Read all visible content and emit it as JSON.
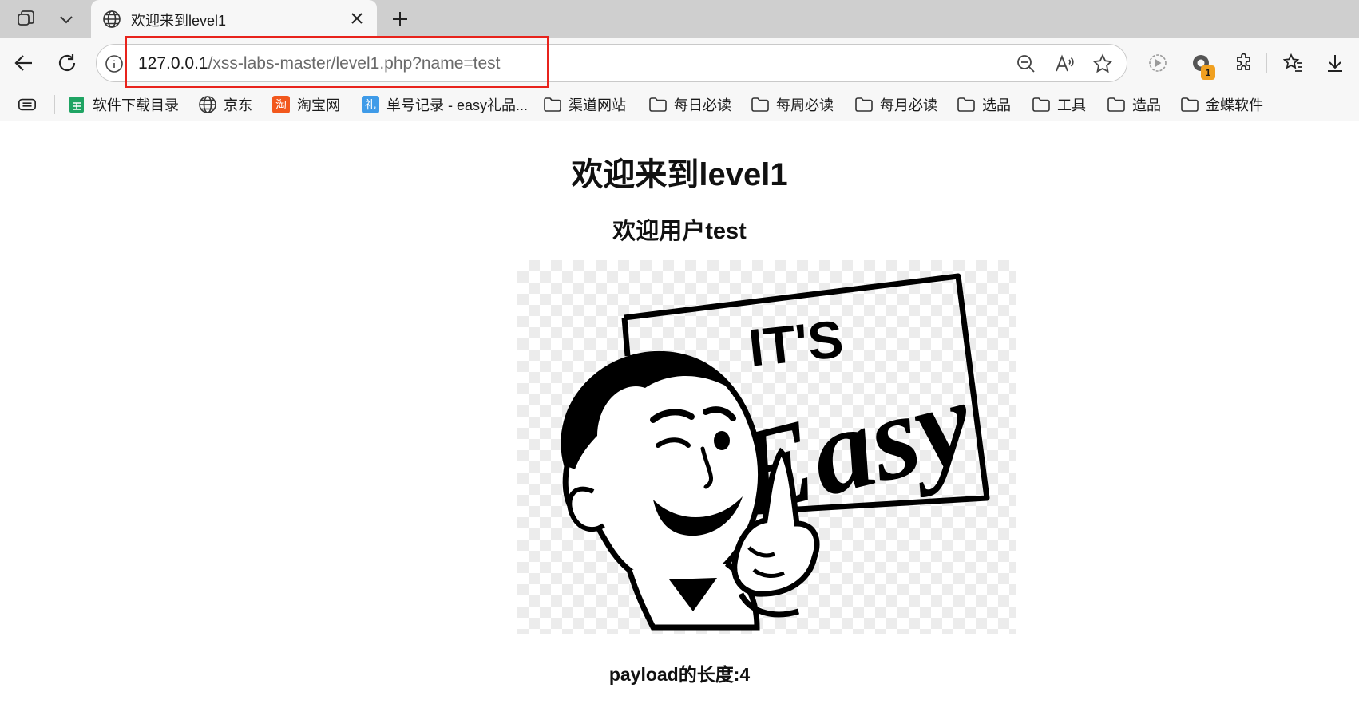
{
  "browser": {
    "tab": {
      "title": "欢迎来到level1"
    },
    "address_bar": {
      "host": "127.0.0.1",
      "path": "/xss-labs-master/level1.php?name=test"
    },
    "extension_badge": "1",
    "bookmarks": [
      {
        "label": "软件下载目录",
        "icon": "sheet-icon"
      },
      {
        "label": "京东",
        "icon": "globe-icon"
      },
      {
        "label": "淘宝网",
        "icon": "taobao-icon"
      },
      {
        "label": "单号记录 - easy礼品...",
        "icon": "gift-icon"
      },
      {
        "label": "渠道网站",
        "icon": "folder-icon"
      },
      {
        "label": "每日必读",
        "icon": "folder-icon"
      },
      {
        "label": "每周必读",
        "icon": "folder-icon"
      },
      {
        "label": "每月必读",
        "icon": "folder-icon"
      },
      {
        "label": "选品",
        "icon": "folder-icon"
      },
      {
        "label": "工具",
        "icon": "folder-icon"
      },
      {
        "label": "造品",
        "icon": "folder-icon"
      },
      {
        "label": "金蝶软件",
        "icon": "folder-icon"
      }
    ],
    "bookmark_glyphs": {
      "taobao": "淘",
      "gift": "礼"
    }
  },
  "page": {
    "heading": "欢迎来到level1",
    "welcome": "欢迎用户test",
    "image": {
      "sign_line1": "IT'S",
      "sign_line2": "Easy"
    },
    "payload_label": "payload的长度:",
    "payload_length": "4"
  },
  "colors": {
    "highlight": "#e8231c",
    "tabstrip": "#cfcfcf",
    "toolbar": "#f7f7f7",
    "badge": "#f0a020"
  }
}
